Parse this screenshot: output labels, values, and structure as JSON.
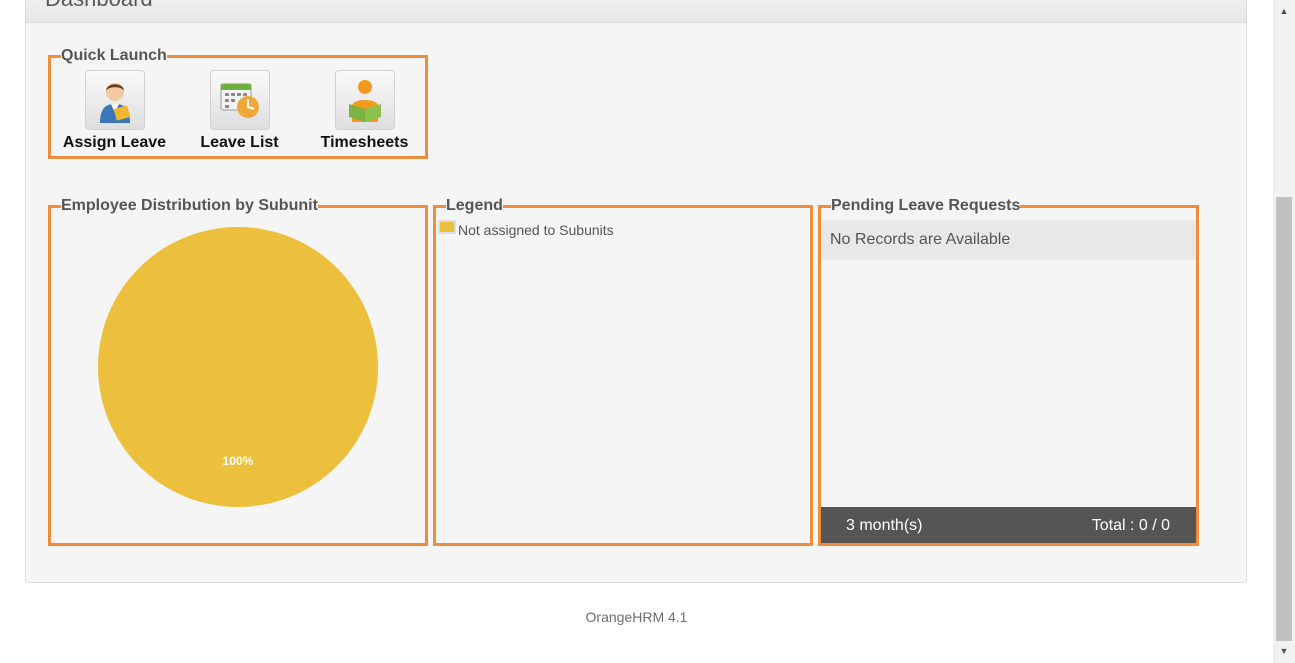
{
  "page": {
    "title": "Dashboard"
  },
  "quick_launch": {
    "title": "Quick Launch",
    "items": [
      {
        "label": "Assign Leave",
        "icon": "assign-leave-icon"
      },
      {
        "label": "Leave List",
        "icon": "leave-list-icon"
      },
      {
        "label": "Timesheets",
        "icon": "timesheets-icon"
      }
    ]
  },
  "distribution": {
    "title": "Employee Distribution by Subunit"
  },
  "legend": {
    "title": "Legend",
    "items": [
      {
        "label": "Not assigned to Subunits",
        "color": "#ecc03c"
      }
    ]
  },
  "pending": {
    "title": "Pending Leave Requests",
    "empty_message": "No Records are Available",
    "period": "3 month(s)",
    "total": "Total : 0 / 0"
  },
  "chart_data": {
    "type": "pie",
    "slices": [
      {
        "label": "Not assigned to Subunits",
        "value": 100,
        "data_label": "100%",
        "color": "#ecc03c"
      }
    ]
  },
  "footer": {
    "text": "OrangeHRM 4.1"
  },
  "colors": {
    "accent": "#ee8e3d",
    "pie": "#ecc03c",
    "footer_bar": "#555555"
  }
}
